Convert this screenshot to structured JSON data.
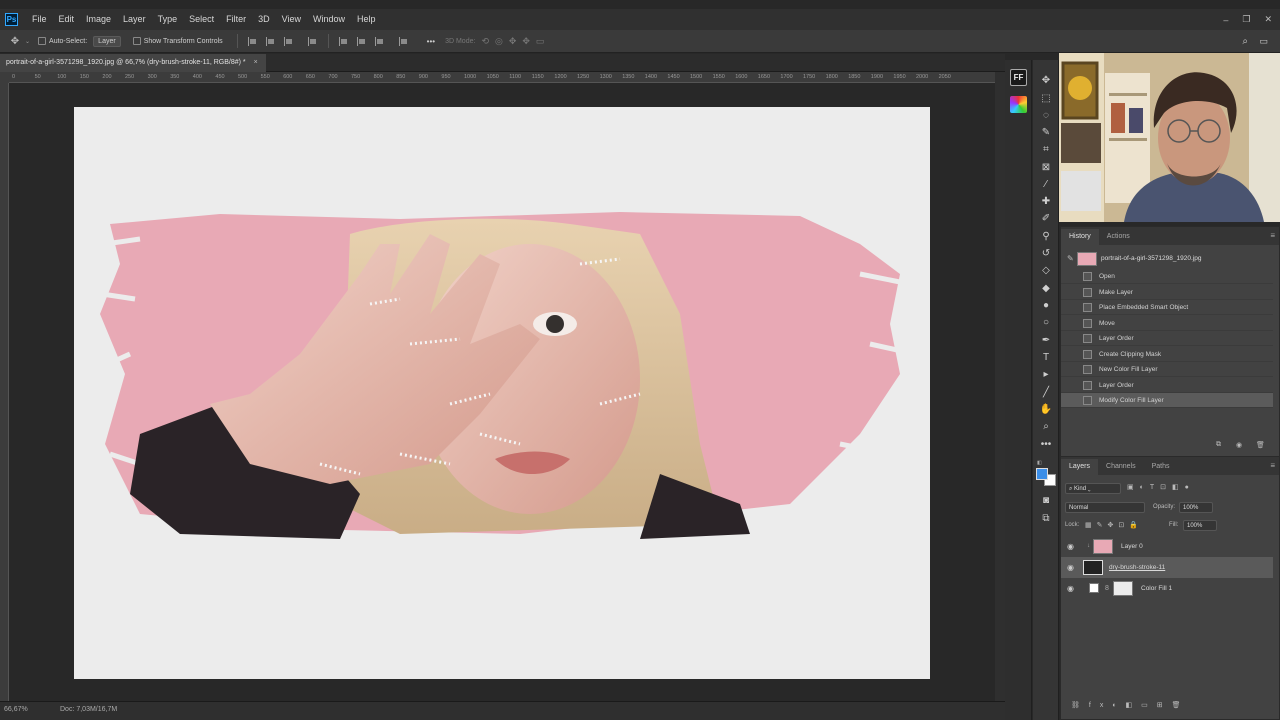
{
  "menubar": {
    "logo": "Ps",
    "items": [
      "File",
      "Edit",
      "Image",
      "Layer",
      "Type",
      "Select",
      "Filter",
      "3D",
      "View",
      "Window",
      "Help"
    ],
    "controls": [
      "–",
      "❐",
      "✕"
    ]
  },
  "options": {
    "auto_select_label": "Auto-Select:",
    "auto_select_target": "Layer",
    "transform_label": "Show Transform Controls",
    "mode_3d": "3D Mode:",
    "more": "•••"
  },
  "document": {
    "tab_title": "portrait-of-a-girl-3571298_1920.jpg @ 66,7% (dry-brush-stroke-11, RGB/8#) *",
    "close": "×",
    "ruler_ticks": [
      "0",
      "50",
      "100",
      "150",
      "200",
      "250",
      "300",
      "350",
      "400",
      "450",
      "500",
      "550",
      "600",
      "650",
      "700",
      "750",
      "800",
      "850",
      "900",
      "950",
      "1000",
      "1050",
      "1100",
      "1150",
      "1200",
      "1250",
      "1300",
      "1350",
      "1400",
      "1450",
      "1500",
      "1550",
      "1600",
      "1650",
      "1700",
      "1750",
      "1800",
      "1850",
      "1900",
      "1950",
      "2000",
      "2050"
    ],
    "zoom": "66,67%",
    "doc_size": "Doc: 7,03M/16,7M"
  },
  "history": {
    "tabs": [
      "History",
      "Actions"
    ],
    "snapshot": "portrait-of-a-girl-3571298_1920.jpg",
    "steps": [
      "Open",
      "Make Layer",
      "Place Embedded Smart Object",
      "Move",
      "Layer Order",
      "Create Clipping Mask",
      "New Color Fill Layer",
      "Layer Order",
      "Modify Color Fill Layer"
    ],
    "active_index": 8
  },
  "layers": {
    "tabs": [
      "Layers",
      "Channels",
      "Paths"
    ],
    "kind": "Kind",
    "blend_mode": "Normal",
    "opacity_label": "Opacity:",
    "opacity": "100%",
    "lock_label": "Lock:",
    "fill_label": "Fill:",
    "fill": "100%",
    "items": [
      {
        "name": "Layer 0",
        "clipped": true
      },
      {
        "name": "dry-brush-stroke-11",
        "selected": true
      },
      {
        "name": "Color Fill 1"
      }
    ]
  },
  "colors": {
    "foreground": "#3b8ee8",
    "background": "#ffffff",
    "pink": "#e8a9b5"
  }
}
